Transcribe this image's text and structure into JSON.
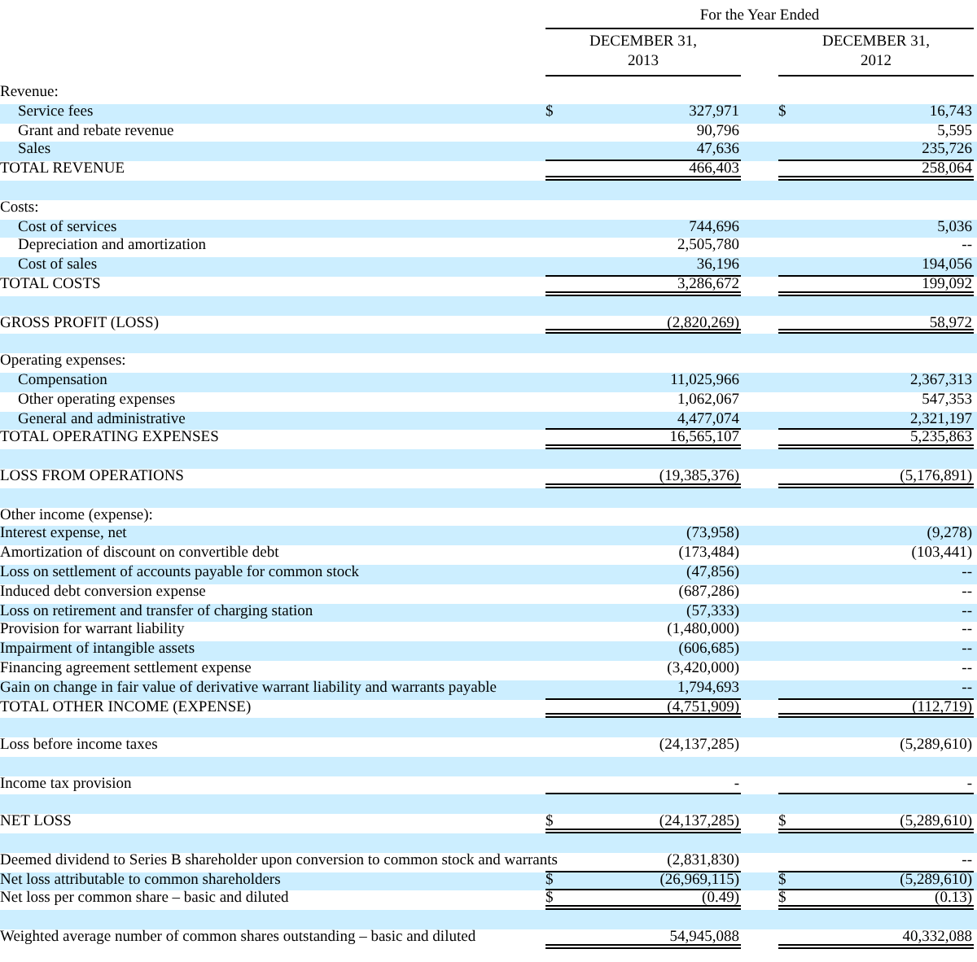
{
  "header": {
    "period": "For the Year Ended",
    "columns": [
      {
        "line1": "DECEMBER 31,",
        "line2": "2013"
      },
      {
        "line1": "DECEMBER 31,",
        "line2": "2012"
      }
    ]
  },
  "rows": [
    {
      "kind": "heading",
      "label": "Revenue:"
    },
    {
      "kind": "subitem",
      "label": "Service fees",
      "c1": "$",
      "v1": "327,971",
      "c2": "$",
      "v2": "16,743"
    },
    {
      "kind": "subitem",
      "label": "Grant and rebate revenue",
      "v1": "90,796",
      "v2": "5,595"
    },
    {
      "kind": "subitem",
      "label": "Sales",
      "v1": "47,636",
      "v2": "235,726",
      "underlined": true
    },
    {
      "kind": "item",
      "label": "TOTAL REVENUE",
      "v1": "466,403",
      "v2": "258,064",
      "double_underlined": true
    },
    {
      "kind": "spacer"
    },
    {
      "kind": "heading",
      "label": "Costs:"
    },
    {
      "kind": "subitem",
      "label": "Cost of services",
      "v1": "744,696",
      "v2": "5,036"
    },
    {
      "kind": "subitem",
      "label": "Depreciation and amortization",
      "v1": "2,505,780",
      "v2": "--"
    },
    {
      "kind": "subitem",
      "label": "Cost of sales",
      "v1": "36,196",
      "v2": "194,056",
      "underlined": true
    },
    {
      "kind": "item",
      "label": "TOTAL COSTS",
      "v1": "3,286,672",
      "v2": "199,092",
      "double_underlined": true
    },
    {
      "kind": "spacer"
    },
    {
      "kind": "item",
      "label": "GROSS PROFIT (LOSS)",
      "v1": "(2,820,269)",
      "v2": "58,972",
      "double_underlined": true
    },
    {
      "kind": "spacer"
    },
    {
      "kind": "heading",
      "label": "Operating expenses:"
    },
    {
      "kind": "subitem",
      "label": "Compensation",
      "v1": "11,025,966",
      "v2": "2,367,313"
    },
    {
      "kind": "subitem",
      "label": "Other operating expenses",
      "v1": "1,062,067",
      "v2": "547,353"
    },
    {
      "kind": "subitem",
      "label": "General and administrative",
      "v1": "4,477,074",
      "v2": "2,321,197",
      "underlined": true
    },
    {
      "kind": "item",
      "label": "TOTAL OPERATING EXPENSES",
      "v1": "16,565,107",
      "v2": "5,235,863",
      "double_underlined": true
    },
    {
      "kind": "spacer"
    },
    {
      "kind": "item",
      "label": "LOSS FROM OPERATIONS",
      "v1": "(19,385,376)",
      "v2": "(5,176,891)",
      "double_underlined": true
    },
    {
      "kind": "spacer"
    },
    {
      "kind": "heading",
      "label": "Other income (expense):"
    },
    {
      "kind": "item",
      "label": "Interest expense, net",
      "v1": "(73,958)",
      "v2": "(9,278)"
    },
    {
      "kind": "item",
      "label": "Amortization of discount on convertible debt",
      "v1": "(173,484)",
      "v2": "(103,441)"
    },
    {
      "kind": "item",
      "label": "Loss on settlement of accounts payable for common stock",
      "v1": "(47,856)",
      "v2": "--"
    },
    {
      "kind": "item",
      "label": "Induced debt conversion expense",
      "v1": "(687,286)",
      "v2": "--"
    },
    {
      "kind": "item",
      "label": "Loss on retirement and transfer of charging station",
      "v1": "(57,333)",
      "v2": "--"
    },
    {
      "kind": "item",
      "label": "Provision for warrant liability",
      "v1": "(1,480,000)",
      "v2": "--"
    },
    {
      "kind": "item",
      "label": "Impairment of intangible assets",
      "v1": "(606,685)",
      "v2": "--"
    },
    {
      "kind": "item",
      "label": "Financing agreement settlement expense",
      "v1": "(3,420,000)",
      "v2": "--"
    },
    {
      "kind": "item",
      "label": "Gain on change in fair value of derivative warrant liability and warrants payable",
      "v1": "1,794,693",
      "v2": "--",
      "underlined": true
    },
    {
      "kind": "item",
      "label": "TOTAL OTHER INCOME (EXPENSE)",
      "v1": "(4,751,909)",
      "v2": "(112,719)",
      "double_underlined": true
    },
    {
      "kind": "spacer"
    },
    {
      "kind": "item",
      "label": "Loss before income taxes",
      "v1": "(24,137,285)",
      "v2": "(5,289,610)"
    },
    {
      "kind": "spacer"
    },
    {
      "kind": "item",
      "label": "Income tax provision",
      "v1": "-",
      "v2": "-",
      "underlined": true
    },
    {
      "kind": "spacer"
    },
    {
      "kind": "item",
      "label": "NET LOSS",
      "c1": "$",
      "v1": "(24,137,285)",
      "c2": "$",
      "v2": "(5,289,610)",
      "double_underlined": true
    },
    {
      "kind": "spacer"
    },
    {
      "kind": "item",
      "label": "Deemed dividend to Series B shareholder upon conversion to common stock and warrants",
      "v1": "(2,831,830)",
      "v2": "--",
      "underlined": true
    },
    {
      "kind": "item",
      "label": "Net loss attributable to common shareholders",
      "c1": "$",
      "v1": "(26,969,115)",
      "c2": "$",
      "v2": "(5,289,610)",
      "underlined": true
    },
    {
      "kind": "item",
      "label": "Net loss per common share – basic and diluted",
      "c1": "$",
      "v1": "(0.49)",
      "c2": "$",
      "v2": "(0.13)",
      "double_underlined": true
    },
    {
      "kind": "spacer"
    },
    {
      "kind": "item",
      "label": "Weighted average number of common shares outstanding – basic and diluted",
      "v1": "54,945,088",
      "v2": "40,332,088",
      "double_underlined": true
    }
  ]
}
